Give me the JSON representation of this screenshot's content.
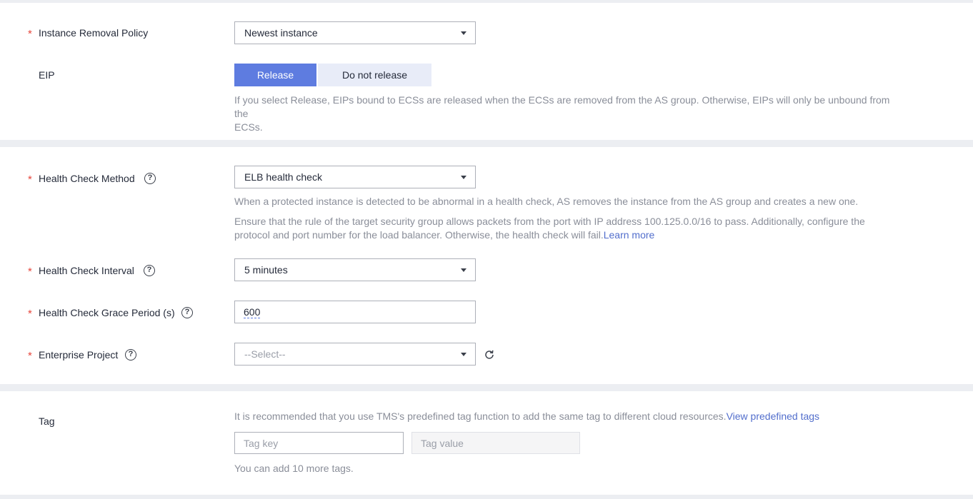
{
  "removal": {
    "label": "Instance Removal Policy",
    "value": "Newest instance"
  },
  "eip": {
    "label": "EIP",
    "release_label": "Release",
    "no_release_label": "Do not release",
    "hint_line1": "If you select Release, EIPs bound to ECSs are released when the ECSs are removed from the AS group. Otherwise, EIPs will only be unbound from the",
    "hint_line2": "ECSs."
  },
  "health_method": {
    "label": "Health Check Method",
    "value": "ELB health check",
    "hint1": "When a protected instance is detected to be abnormal in a health check, AS removes the instance from the AS group and creates a new one.",
    "hint2_line1": "Ensure that the rule of the target security group allows packets from the port with IP address 100.125.0.0/16 to pass. Additionally, configure the",
    "hint2_line2": "protocol and port number for the load balancer. Otherwise, the health check will fail.",
    "learn_more": "Learn more"
  },
  "health_interval": {
    "label": "Health Check Interval",
    "value": "5 minutes"
  },
  "grace_period": {
    "label": "Health Check Grace Period (s)",
    "value": "600"
  },
  "enterprise_project": {
    "label": "Enterprise Project",
    "placeholder": "--Select--"
  },
  "tag": {
    "label": "Tag",
    "hint": "It is recommended that you use TMS's predefined tag function to add the same tag to different cloud resources.",
    "view_link": "View predefined tags",
    "key_placeholder": "Tag key",
    "value_placeholder": "Tag value",
    "remaining": "You can add 10 more tags."
  },
  "required_mark": "*",
  "help_mark": "?",
  "colors": {
    "primary": "#5e7ce0",
    "required": "#e6463c",
    "link": "#526ecc",
    "hint": "#8a8e99"
  },
  "icons": {
    "caret": "chevron-down-icon",
    "help": "question-circle-icon",
    "refresh": "refresh-icon"
  }
}
